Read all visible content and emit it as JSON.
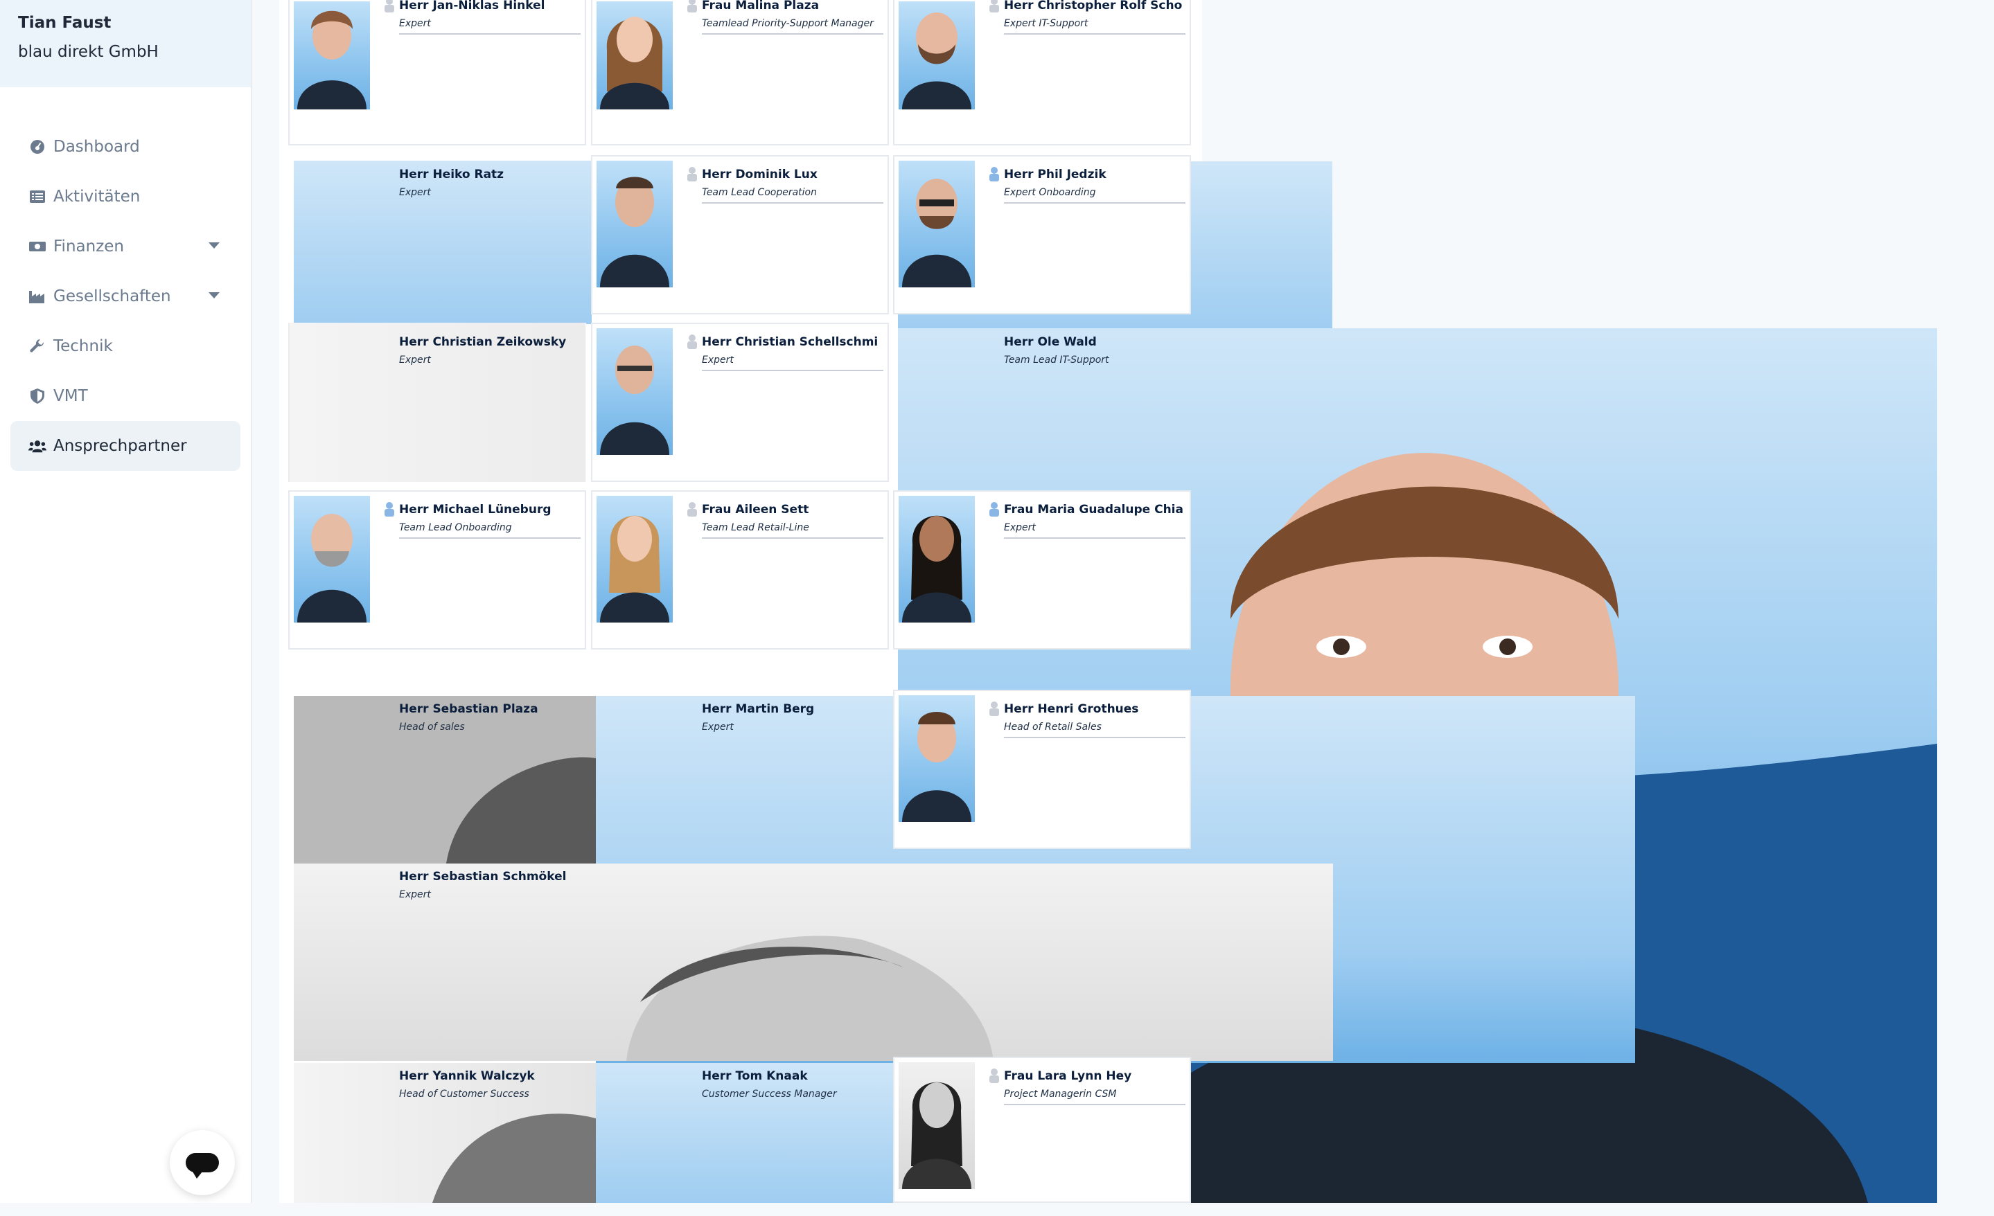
{
  "user": {
    "name": "Tian Faust",
    "company": "blau direkt GmbH"
  },
  "nav": {
    "items": [
      {
        "label": "Dashboard",
        "icon": "dashboard-icon"
      },
      {
        "label": "Aktivitäten",
        "icon": "list-icon"
      },
      {
        "label": "Finanzen",
        "icon": "money-icon",
        "expandable": true
      },
      {
        "label": "Gesellschaften",
        "icon": "factory-icon",
        "expandable": true
      },
      {
        "label": "Technik",
        "icon": "wrench-icon"
      },
      {
        "label": "VMT",
        "icon": "shield-icon"
      },
      {
        "label": "Ansprechpartner",
        "icon": "users-icon",
        "active": true
      }
    ]
  },
  "contacts": [
    {
      "name": "Herr Jan-Niklas Hinkel",
      "title": "Expert"
    },
    {
      "name": "Frau Malina Plaza",
      "title": "Teamlead Priority-Support Manager"
    },
    {
      "name": "Herr Christopher Rolf Scho",
      "title": "Expert IT-Support"
    },
    {
      "name": "Herr Heiko Ratz",
      "title": "Expert"
    },
    {
      "name": "Herr Dominik Lux",
      "title": "Team Lead Cooperation"
    },
    {
      "name": "Herr Phil Jedzik",
      "title": "Expert Onboarding"
    },
    {
      "name": "Herr Christian Zeikowsky",
      "title": "Expert"
    },
    {
      "name": "Herr Christian Schellschmi",
      "title": "Expert"
    },
    {
      "name": "Herr Ole Wald",
      "title": "Team Lead IT-Support"
    },
    {
      "name": "Herr Michael Lüneburg",
      "title": "Team Lead Onboarding"
    },
    {
      "name": "Frau Aileen Sett",
      "title": "Team Lead Retail-Line"
    },
    {
      "name": "Frau Maria Guadalupe Chia",
      "title": "Expert"
    },
    {
      "name": "Herr Sebastian Plaza",
      "title": "Head of sales"
    },
    {
      "name": "Herr Martin Berg",
      "title": "Expert"
    },
    {
      "name": "Herr Henri Grothues",
      "title": "Head of Retail Sales"
    },
    {
      "name": "Herr Sebastian Schmökel",
      "title": "Expert"
    },
    {
      "name": "Herr Yannik Walczyk",
      "title": "Head of Customer Success"
    },
    {
      "name": "Herr Tom Knaak",
      "title": "Customer Success Manager"
    },
    {
      "name": "Frau Lara Lynn Hey",
      "title": "Project Managerin CSM"
    }
  ],
  "colors": {
    "accent": "#6db1e6",
    "sidebar_active": "#edf2f7",
    "user_box": "#ecf4fb"
  }
}
